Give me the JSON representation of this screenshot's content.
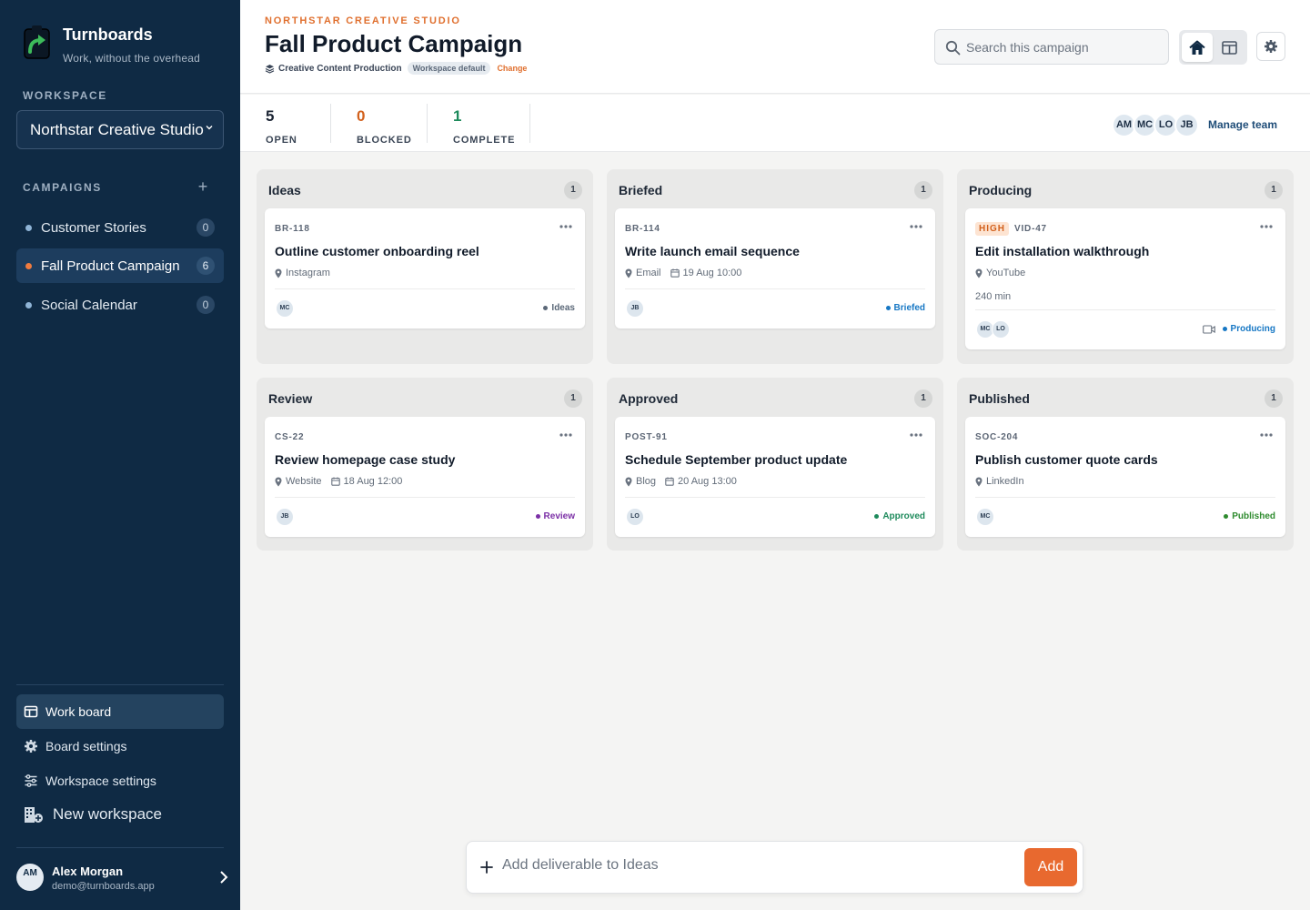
{
  "app": {
    "name": "Turnboards",
    "tagline": "Work, without the overhead"
  },
  "sidebar": {
    "workspace_label": "WORKSPACE",
    "workspace_selected": "Northstar Creative Studio",
    "campaigns_label": "CAMPAIGNS",
    "campaigns": [
      {
        "label": "Customer Stories",
        "count": "0",
        "active": false
      },
      {
        "label": "Fall Product Campaign",
        "count": "6",
        "active": true
      },
      {
        "label": "Social Calendar",
        "count": "0",
        "active": false
      }
    ],
    "nav": [
      {
        "label": "Work board",
        "icon": "board-icon",
        "active": true
      },
      {
        "label": "Board settings",
        "icon": "gear-icon",
        "active": false
      },
      {
        "label": "Workspace settings",
        "icon": "sliders-icon",
        "active": false
      }
    ],
    "new_workspace": "New workspace",
    "user": {
      "initials": "AM",
      "name": "Alex Morgan",
      "email": "demo@turnboards.app"
    }
  },
  "header": {
    "eyebrow": "NORTHSTAR CREATIVE STUDIO",
    "title": "Fall Product Campaign",
    "template_name": "Creative Content Production",
    "template_badge": "Workspace default",
    "change_label": "Change",
    "search_placeholder": "Search this campaign"
  },
  "stats": {
    "open": {
      "value": "5",
      "label": "OPEN"
    },
    "blocked": {
      "value": "0",
      "label": "BLOCKED"
    },
    "complete": {
      "value": "1",
      "label": "COMPLETE"
    },
    "team": [
      "AM",
      "MC",
      "LO",
      "JB"
    ],
    "manage_team": "Manage team"
  },
  "columns": [
    {
      "title": "Ideas",
      "count": "1",
      "card": {
        "id": "BR-118",
        "title": "Outline customer onboarding reel",
        "channel": "Instagram",
        "assignees": [
          "MC"
        ],
        "status": "Ideas"
      }
    },
    {
      "title": "Briefed",
      "count": "1",
      "card": {
        "id": "BR-114",
        "title": "Write launch email sequence",
        "channel": "Email",
        "due": "19 Aug 10:00",
        "assignees": [
          "JB"
        ],
        "status": "Briefed"
      }
    },
    {
      "title": "Producing",
      "count": "1",
      "card": {
        "priority": "HIGH",
        "id": "VID-47",
        "title": "Edit installation walkthrough",
        "channel": "YouTube",
        "extra": "240 min",
        "assignees": [
          "MC",
          "LO"
        ],
        "status": "Producing"
      }
    },
    {
      "title": "Review",
      "count": "1",
      "card": {
        "id": "CS-22",
        "title": "Review homepage case study",
        "channel": "Website",
        "due": "18 Aug 12:00",
        "assignees": [
          "JB"
        ],
        "status": "Review"
      }
    },
    {
      "title": "Approved",
      "count": "1",
      "card": {
        "id": "POST-91",
        "title": "Schedule September product update",
        "channel": "Blog",
        "due": "20 Aug 13:00",
        "assignees": [
          "LO"
        ],
        "status": "Approved"
      }
    },
    {
      "title": "Published",
      "count": "1",
      "card": {
        "id": "SOC-204",
        "title": "Publish customer quote cards",
        "channel": "LinkedIn",
        "assignees": [
          "MC"
        ],
        "status": "Published"
      }
    }
  ],
  "status_colors": {
    "Ideas": "#5b6878",
    "Briefed": "#1677c4",
    "Producing": "#1677c4",
    "Review": "#7b2fa6",
    "Approved": "#1d8a5b",
    "Published": "#2e8b2e"
  },
  "add_bar": {
    "placeholder": "Add deliverable to Ideas",
    "button": "Add"
  },
  "colors": {
    "sidebar_bg": "#0f2a44",
    "accent": "#e8692f",
    "blocked": "#d2611d",
    "complete": "#1d8a5b"
  }
}
